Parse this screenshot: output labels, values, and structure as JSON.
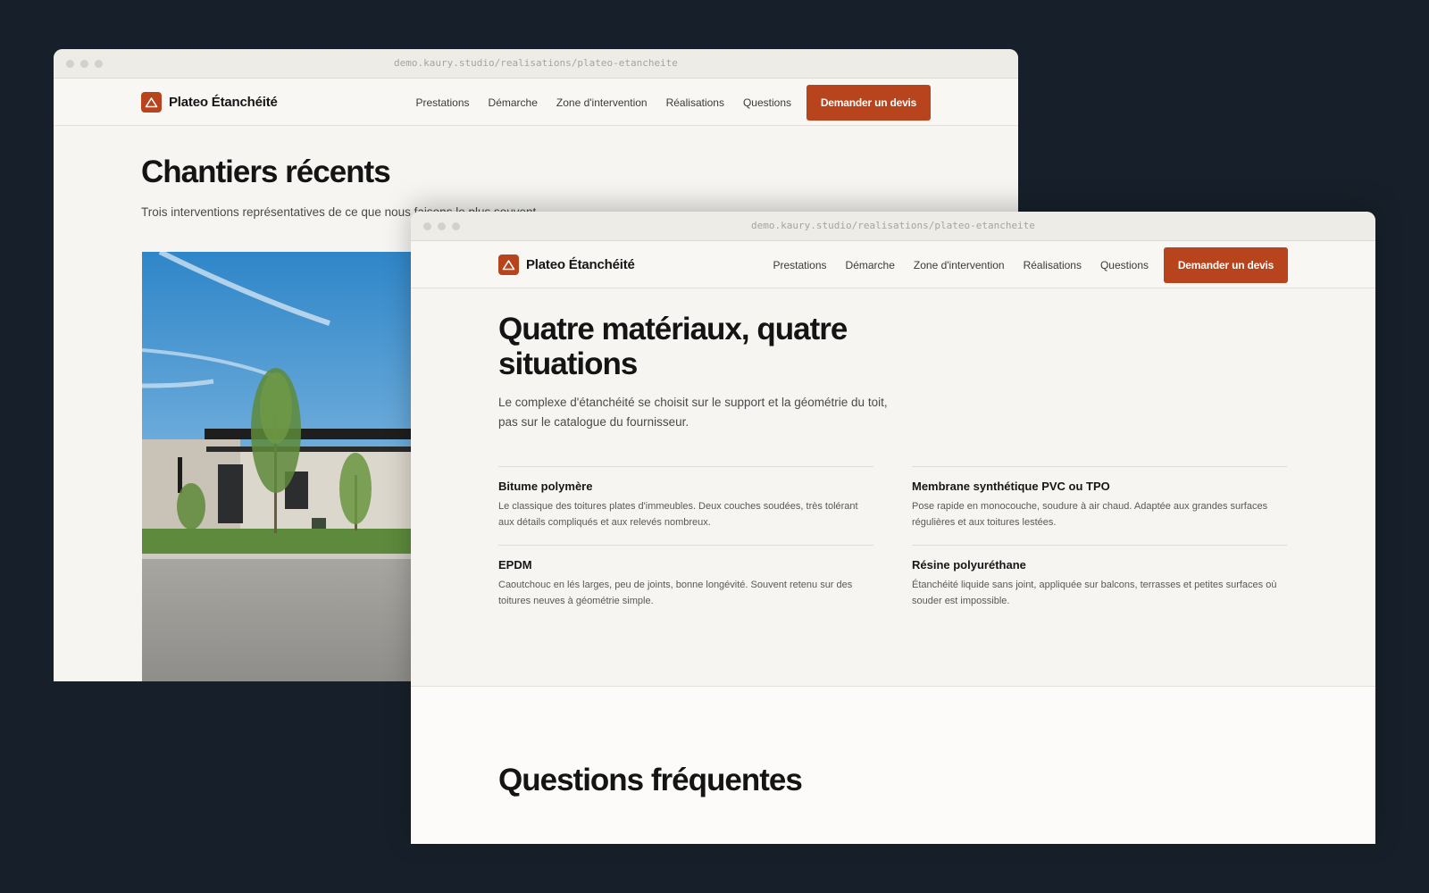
{
  "browser": {
    "url": "demo.kaury.studio/realisations/plateo-etancheite"
  },
  "nav": {
    "brand": "Plateo Étanchéité",
    "links": [
      "Prestations",
      "Démarche",
      "Zone d'intervention",
      "Réalisations",
      "Questions"
    ],
    "cta": "Demander un devis"
  },
  "colors": {
    "accent": "#b8441d",
    "backdrop": "#17202a",
    "page": "#f6f5f2"
  },
  "back_page": {
    "title": "Chantiers récents",
    "subtitle": "Trois interventions représentatives de ce que nous faisons le plus souvent."
  },
  "front_page": {
    "title": "Quatre matériaux, quatre situations",
    "subtitle": "Le complexe d'étanchéité se choisit sur le support et la géométrie du toit, pas sur le catalogue du fournisseur.",
    "materials": [
      {
        "title": "Bitume polymère",
        "desc": "Le classique des toitures plates d'immeubles. Deux couches soudées, très tolérant aux détails compliqués et aux relevés nombreux."
      },
      {
        "title": "Membrane synthétique PVC ou TPO",
        "desc": "Pose rapide en monocouche, soudure à air chaud. Adaptée aux grandes surfaces régulières et aux toitures lestées."
      },
      {
        "title": "EPDM",
        "desc": "Caoutchouc en lés larges, peu de joints, bonne longévité. Souvent retenu sur des toitures neuves à géométrie simple."
      },
      {
        "title": "Résine polyuréthane",
        "desc": "Étanchéité liquide sans joint, appliquée sur balcons, terrasses et petites surfaces où souder est impossible."
      }
    ],
    "faq_title": "Questions fréquentes"
  }
}
